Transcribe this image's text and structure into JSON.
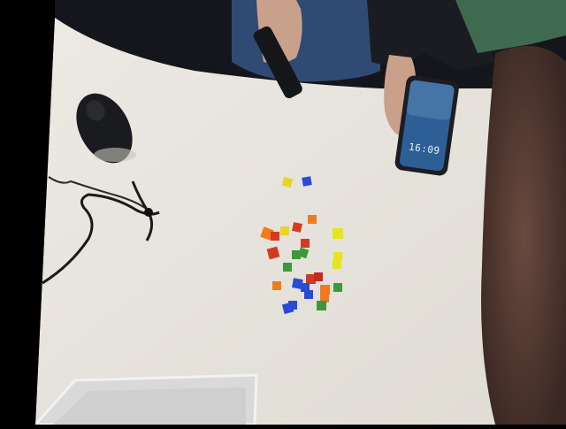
{
  "scene": {
    "description_tags": [
      "desk",
      "cubes",
      "phone",
      "mouse",
      "hands"
    ],
    "colors": {
      "desk": "#e9e6df",
      "shadow": "#cfcbc3",
      "background": "#101217",
      "jeans": "#2f4a73",
      "sleeve": "#1b1c22",
      "skin": "#c9a08a",
      "phone_frame": "#1c1d22",
      "phone_screen": "#2d5f96",
      "mouse": "#1a1b1f",
      "cable": "#1a1a1a",
      "person_right": "#5b3f36",
      "tray": "#d6d6d6"
    },
    "phone_time": "16:09"
  }
}
